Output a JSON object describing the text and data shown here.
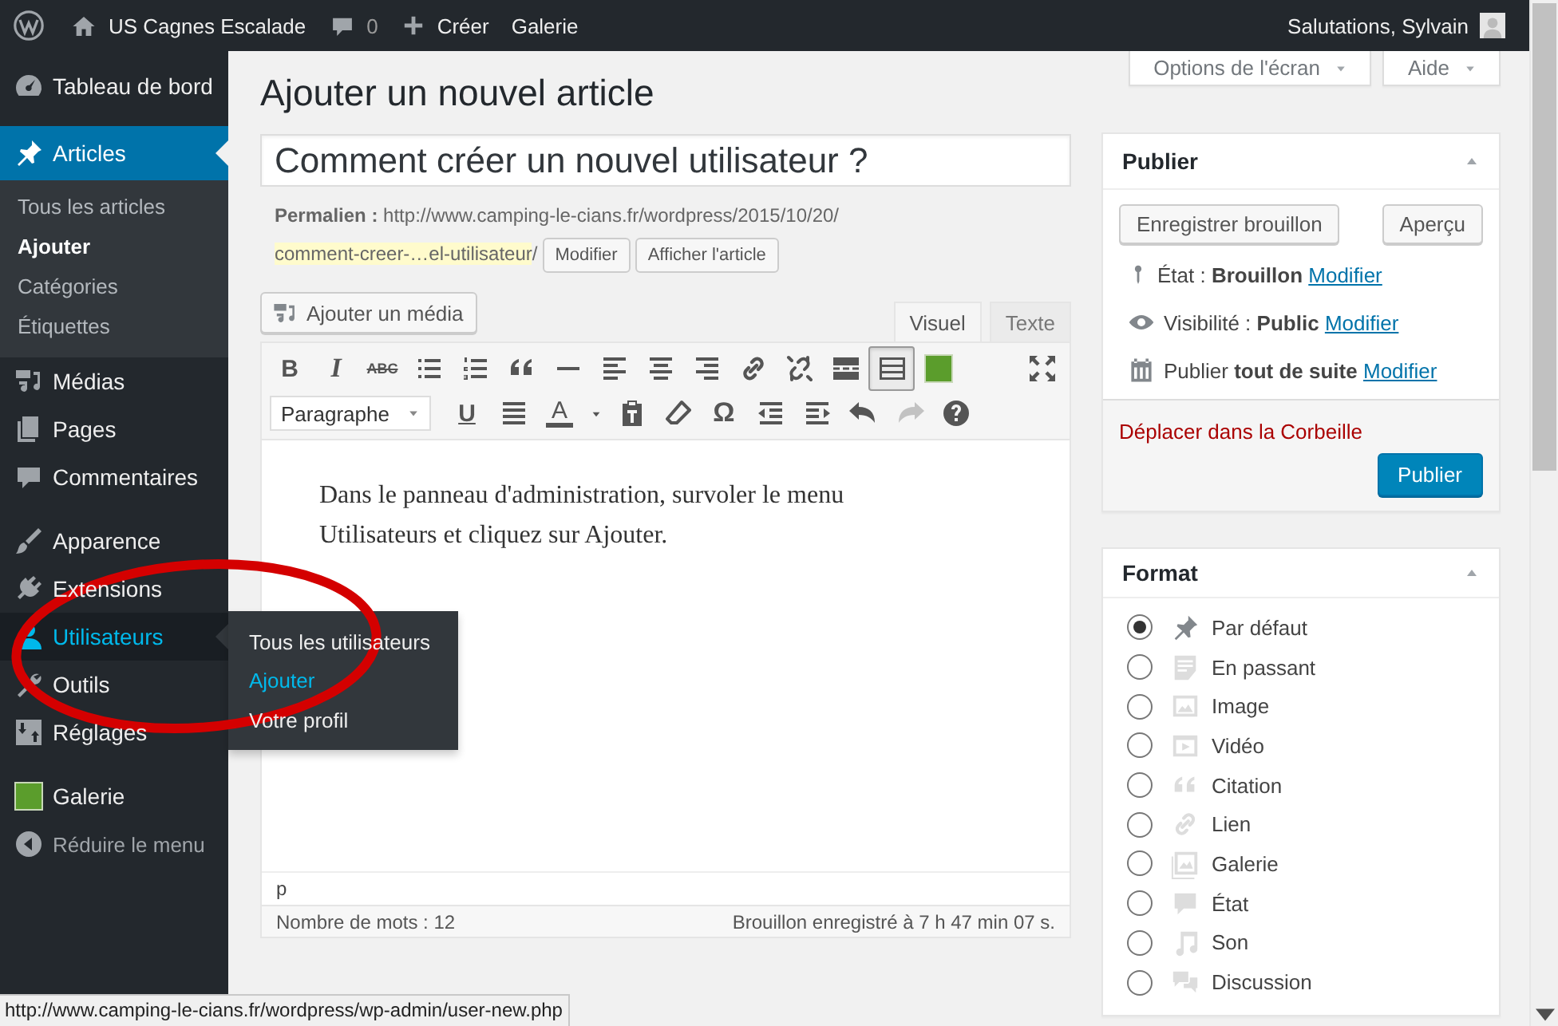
{
  "admin_bar": {
    "site_name": "US Cagnes Escalade",
    "comments_count": "0",
    "new_label": "Créer",
    "gallery_label": "Galerie",
    "greeting": "Salutations, Sylvain"
  },
  "sidebar": {
    "groups": [
      {
        "items": [
          {
            "label": "Tableau de bord",
            "selected": false,
            "hovered": false
          }
        ]
      },
      {
        "items": [
          {
            "label": "Articles",
            "selected": true,
            "hovered": false,
            "submenu": {
              "kind": "inline",
              "items": [
                {
                  "label": "Tous les articles",
                  "selected": false
                },
                {
                  "label": "Ajouter",
                  "selected": true
                },
                {
                  "label": "Catégories",
                  "selected": false
                },
                {
                  "label": "Étiquettes",
                  "selected": false
                }
              ]
            }
          },
          {
            "label": "Médias",
            "selected": false,
            "hovered": false
          },
          {
            "label": "Pages",
            "selected": false,
            "hovered": false
          },
          {
            "label": "Commentaires",
            "selected": false,
            "hovered": false
          }
        ]
      },
      {
        "items": [
          {
            "label": "Apparence",
            "selected": false,
            "hovered": false
          },
          {
            "label": "Extensions",
            "selected": false,
            "hovered": false
          },
          {
            "label": "Utilisateurs",
            "selected": false,
            "hovered": true,
            "submenu": {
              "kind": "flyout",
              "items": [
                {
                  "label": "Tous les utilisateurs",
                  "hovered": false
                },
                {
                  "label": "Ajouter",
                  "hovered": true
                },
                {
                  "label": "Votre profil",
                  "hovered": false
                }
              ]
            }
          },
          {
            "label": "Outils",
            "selected": false,
            "hovered": false
          },
          {
            "label": "Réglages",
            "selected": false,
            "hovered": false
          }
        ]
      },
      {
        "items": [
          {
            "label": "Galerie",
            "selected": false,
            "hovered": false
          }
        ]
      }
    ],
    "collapse_label": "Réduire le menu"
  },
  "screen_meta": {
    "buttons": [
      "Options de l'écran",
      "Aide"
    ]
  },
  "page_title": "Ajouter un nouvel article",
  "post_title": {
    "value": "Comment créer un nouvel utilisateur ?"
  },
  "permalink": {
    "label": "Permalien :",
    "base_url": "http://www.camping-le-cians.fr/wordpress/2015/10/20/",
    "slug": "comment-creer-…el-utilisateur",
    "trailing": "/",
    "buttons": [
      "Modifier",
      "Afficher l'article"
    ]
  },
  "editor": {
    "add_media": "Ajouter un média",
    "tabs": [
      {
        "label": "Visuel",
        "selected": true
      },
      {
        "label": "Texte",
        "selected": false
      }
    ],
    "toolbar_rows": [
      {
        "buttons": [
          {
            "kind": "text",
            "label": "B",
            "pressed": false
          },
          {
            "kind": "text",
            "label": "I",
            "pressed": false
          },
          {
            "kind": "text",
            "label": "ABC",
            "pressed": false
          },
          {
            "kind": "icon",
            "pressed": false
          },
          {
            "kind": "icon",
            "pressed": false
          },
          {
            "kind": "icon",
            "pressed": false
          },
          {
            "kind": "icon",
            "pressed": false
          },
          {
            "kind": "icon",
            "pressed": false
          },
          {
            "kind": "icon",
            "pressed": false
          },
          {
            "kind": "icon",
            "pressed": false
          },
          {
            "kind": "icon",
            "pressed": false
          },
          {
            "kind": "icon",
            "pressed": false
          },
          {
            "kind": "icon",
            "pressed": false
          },
          {
            "kind": "icon",
            "pressed": true
          },
          {
            "kind": "icon",
            "pressed": false
          },
          {
            "kind": "icon",
            "pressed": false
          }
        ]
      },
      {
        "buttons": [
          {
            "kind": "select",
            "value": "Paragraphe"
          },
          {
            "kind": "text",
            "label": "U",
            "disabled": false
          },
          {
            "kind": "icon",
            "disabled": false
          },
          {
            "kind": "text",
            "label": "A",
            "disabled": false
          },
          {
            "kind": "icon",
            "disabled": false
          },
          {
            "kind": "icon",
            "disabled": false
          },
          {
            "kind": "icon",
            "disabled": false
          },
          {
            "kind": "text",
            "label": "Ω",
            "disabled": false
          },
          {
            "kind": "icon",
            "disabled": false
          },
          {
            "kind": "icon",
            "disabled": false
          },
          {
            "kind": "icon",
            "disabled": false
          },
          {
            "kind": "icon",
            "disabled": true
          },
          {
            "kind": "icon",
            "disabled": false
          }
        ]
      }
    ],
    "content": "Dans le panneau d'administration, survoler le menu Utilisateurs et cliquez sur Ajouter.",
    "path": "p",
    "word_count": "Nombre de mots : 12",
    "saved_status": "Brouillon enregistré à 7 h 47 min 07 s."
  },
  "publish_box": {
    "title": "Publier",
    "save_draft": "Enregistrer brouillon",
    "preview": "Aperçu",
    "rows": [
      {
        "label": "État :",
        "value": "Brouillon",
        "link": "Modifier"
      },
      {
        "label": "Visibilité :",
        "value": "Public",
        "link": "Modifier"
      },
      {
        "label": "Publier",
        "value": "tout de suite",
        "link": "Modifier"
      }
    ],
    "trash": "Déplacer dans la Corbeille",
    "publish": "Publier"
  },
  "format_box": {
    "title": "Format",
    "options": [
      {
        "label": "Par défaut",
        "selected": true
      },
      {
        "label": "En passant",
        "selected": false
      },
      {
        "label": "Image",
        "selected": false
      },
      {
        "label": "Vidéo",
        "selected": false
      },
      {
        "label": "Citation",
        "selected": false
      },
      {
        "label": "Lien",
        "selected": false
      },
      {
        "label": "Galerie",
        "selected": false
      },
      {
        "label": "État",
        "selected": false
      },
      {
        "label": "Son",
        "selected": false
      },
      {
        "label": "Discussion",
        "selected": false
      }
    ]
  },
  "status_url": "http://www.camping-le-cians.fr/wordpress/wp-admin/user-new.php"
}
